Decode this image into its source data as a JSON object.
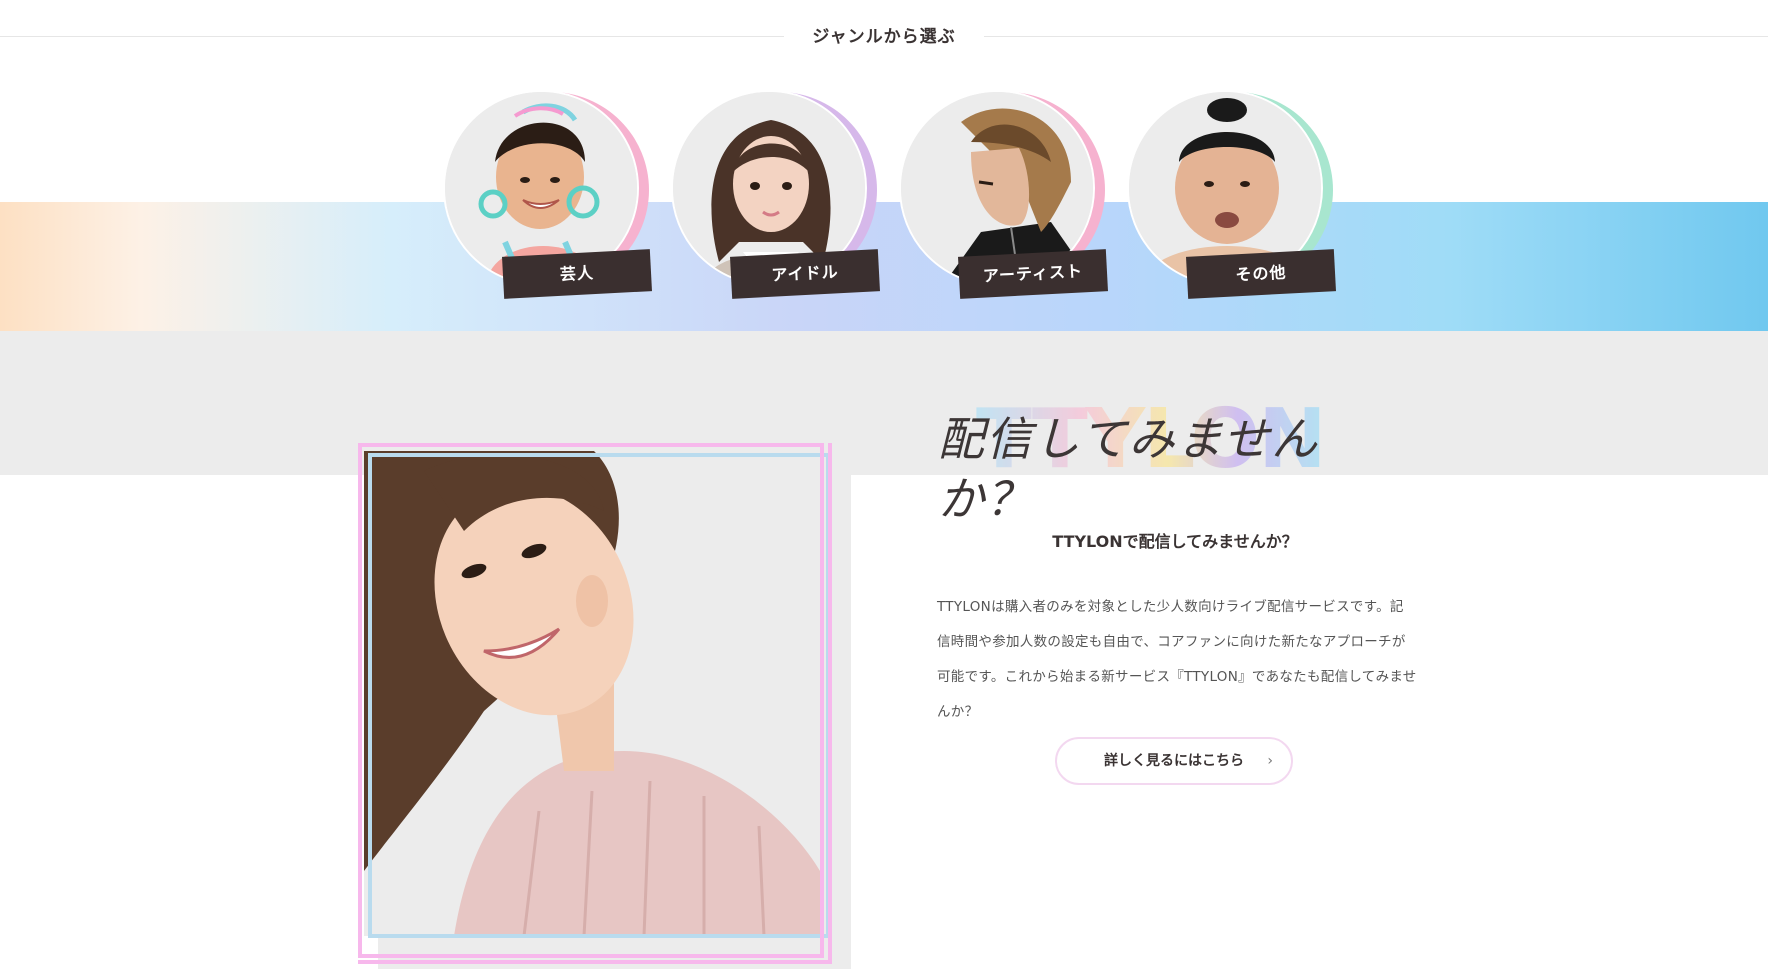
{
  "genre_section": {
    "heading": "ジャンルから選ぶ",
    "items": [
      {
        "label": "芸人",
        "accent": "#f6b2cf"
      },
      {
        "label": "アイドル",
        "accent": "#d6b8ea"
      },
      {
        "label": "アーティスト",
        "accent": "#f6b2cf"
      },
      {
        "label": "その他",
        "accent": "#a8e6cf"
      }
    ]
  },
  "promo": {
    "logo_text": "TTYLON",
    "tagline": "配信してみませんか？",
    "subtitle": "TTYLONで配信してみませんか？",
    "description": "TTYLONは購入者のみを対象とした少人数向けライブ配信サービスです。記信時間や参加人数の設定も自由で、コアファンに向けた新たなアプローチが可能です。これから始まる新サービス『TTYLON』であなたも配信してみませんか？",
    "button_label": "詳しく見るにはこちら",
    "button_icon": "chevron-right-icon",
    "chevron": "›"
  },
  "colors": {
    "frame_pink": "#f7b8ec",
    "frame_blue": "#b9dbee",
    "label_bg": "#3a2f2f",
    "grey_band": "#ececec"
  }
}
